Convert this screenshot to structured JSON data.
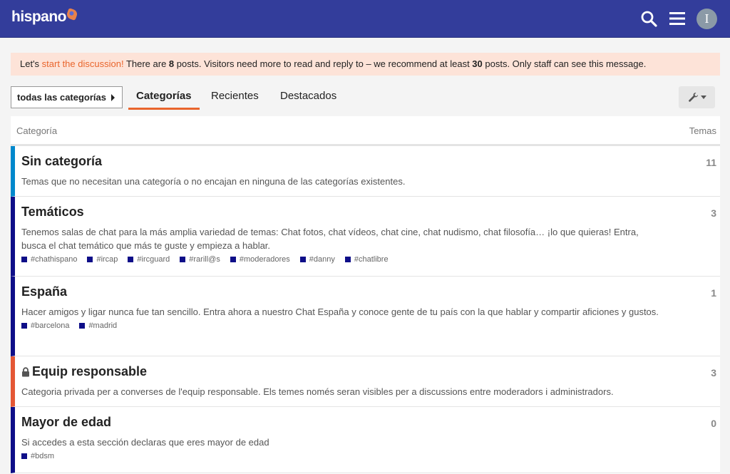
{
  "header": {
    "logo_text": "hispano",
    "icons": [
      "search-icon",
      "hamburger-menu-icon"
    ],
    "avatar_letter": "I",
    "colors": {
      "bar": "#333d9b",
      "accent": "#e9652c"
    }
  },
  "notice": {
    "prefix": "Let's ",
    "link": "start the discussion!",
    "mid1": " There are ",
    "posts": "8",
    "mid2": " posts. Visitors need more to read and reply to – we recommend at least ",
    "recommended": "30",
    "suffix": " posts. Only staff can see this message."
  },
  "nav": {
    "category_dropdown": "todas las categorías",
    "tabs": [
      "Categorías",
      "Recientes",
      "Destacados"
    ],
    "active_tab": "Categorías",
    "tools_icon": "wrench-icon"
  },
  "table": {
    "col_category": "Categoría",
    "col_topics": "Temas",
    "rows": [
      {
        "name": "Sin categoría",
        "desc": "Temas que no necesitan una categoría o no encajan en ninguna de las categorías existentes.",
        "count": "11",
        "color": "#0088cc",
        "subs": []
      },
      {
        "name": "Temáticos",
        "desc": "Tenemos salas de chat para la más amplia variedad de temas: Chat fotos, chat vídeos, chat cine, chat nudismo, chat filosofía… ¡lo que quieras! Entra, busca el chat temático que más te guste y empieza a hablar.",
        "count": "3",
        "color": "#0e0e88",
        "subs": [
          "#chathispano",
          "#ircap",
          "#ircguard",
          "#rarill@s",
          "#moderadores",
          "#danny",
          "#chatlibre"
        ]
      },
      {
        "name": "España",
        "desc": "Hacer amigos y ligar nunca fue tan sencillo. Entra ahora a nuestro Chat España y conoce gente de tu país con la que hablar y compartir aficiones y gustos.",
        "count": "1",
        "color": "#0e0e88",
        "subs": [
          "#barcelona",
          "#madrid"
        ]
      },
      {
        "name": "Equip responsable",
        "desc": "Categoria privada per a converses de l'equip responsable. Els temes només seran visibles per a discussions entre moderadors i administradors.",
        "count": "3",
        "color": "#e45735",
        "locked": true,
        "subs": []
      },
      {
        "name": "Mayor de edad",
        "desc": "Si accedes a esta sección declaras que eres mayor de edad",
        "count": "0",
        "color": "#0e0e88",
        "subs": [
          "#bdsm"
        ]
      }
    ]
  }
}
